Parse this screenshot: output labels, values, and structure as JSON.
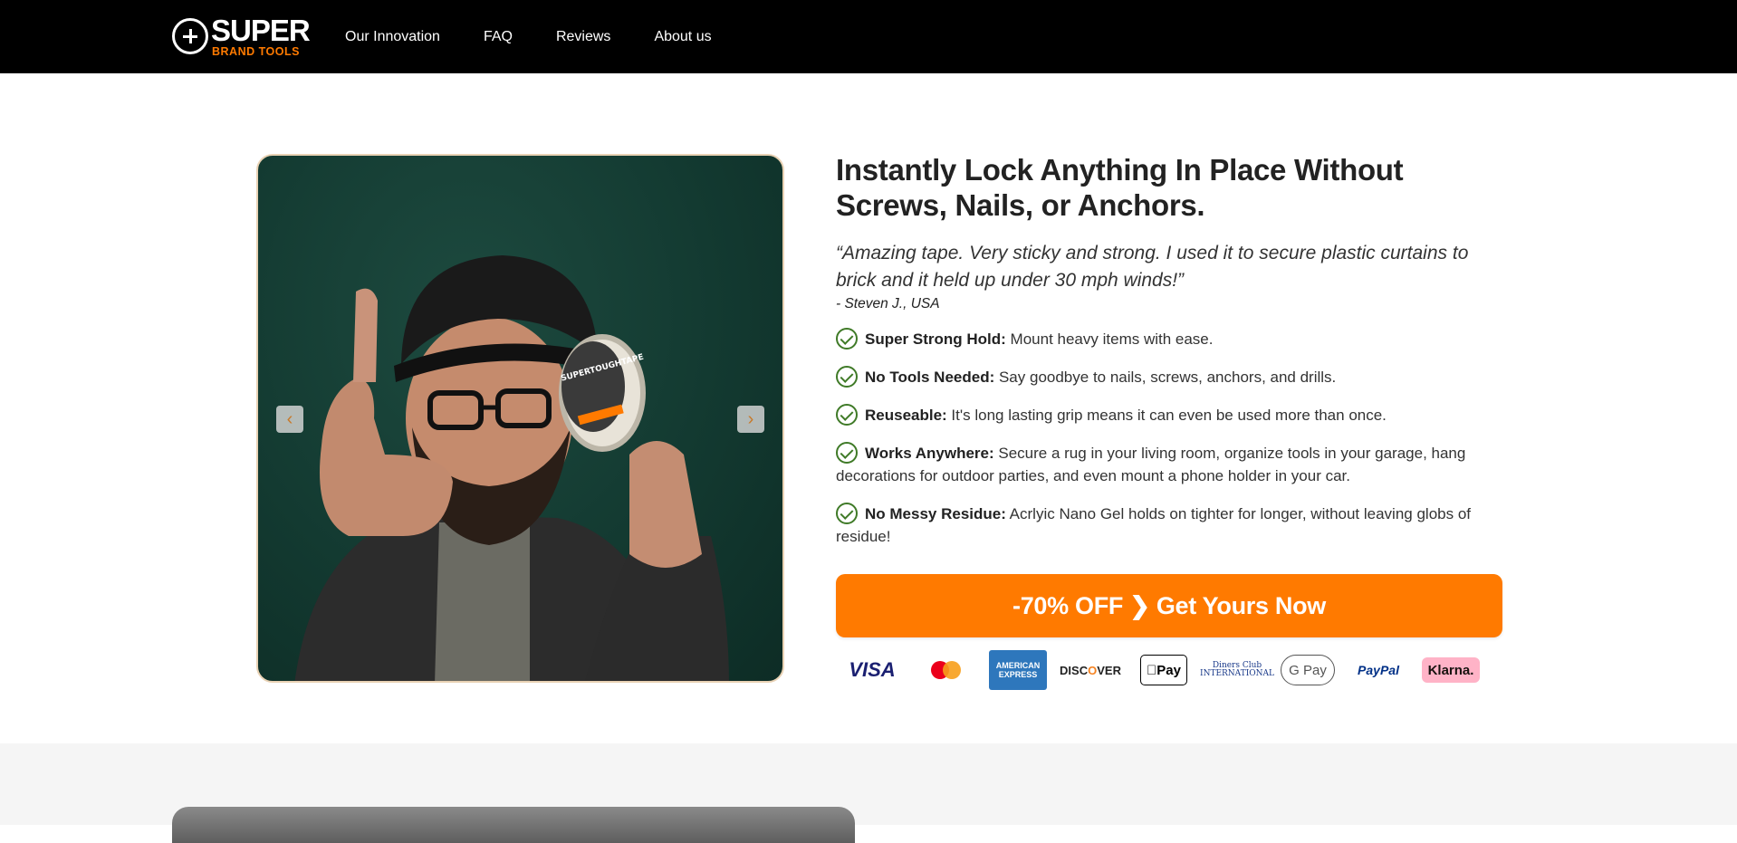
{
  "brand": {
    "name_top": "SUPER",
    "name_bottom": "BRAND TOOLS",
    "accent_color": "#ff7a00"
  },
  "nav": {
    "items": [
      {
        "label": "Our Innovation"
      },
      {
        "label": "FAQ"
      },
      {
        "label": "Reviews"
      },
      {
        "label": "About us"
      }
    ]
  },
  "hero": {
    "image_alt": "Man holding SuperToughTape roll giving thumbs up",
    "prev_icon": "chevron-left-icon",
    "next_icon": "chevron-right-icon",
    "headline": "Instantly Lock Anything In Place Without Screws, Nails, or Anchors.",
    "quote": "“Amazing tape. Very sticky and strong. I used it to secure plastic curtains to brick and it held up under 30 mph winds!”",
    "quote_author": "- Steven J., USA",
    "features": [
      {
        "title": "Super Strong Hold:",
        "text": " Mount heavy items with ease."
      },
      {
        "title": "No Tools Needed:",
        "text": " Say goodbye to nails, screws, anchors, and drills."
      },
      {
        "title": "Reuseable:",
        "text": " It's long lasting grip means it can even be used more than once."
      },
      {
        "title": "Works Anywhere:",
        "text": " Secure a rug in your living room, organize tools in your garage, hang decorations for outdoor parties, and even mount a phone holder in your car."
      },
      {
        "title": "No Messy Residue:",
        "text": " Acrlyic Nano Gel holds on tighter for longer, without leaving globs of residue!"
      }
    ],
    "cta_label": "-70% OFF ❯ Get Yours Now",
    "cta_color": "#ff7a00"
  },
  "payments": {
    "visa": "VISA",
    "amex": "AMERICAN EXPRESS",
    "discover_a": "DISC",
    "discover_o": "O",
    "discover_b": "VER",
    "applepay": "Pay",
    "diners": "Diners Club INTERNATIONAL",
    "gpay": "G Pay",
    "paypal": "PayPal",
    "klarna": "Klarna."
  }
}
